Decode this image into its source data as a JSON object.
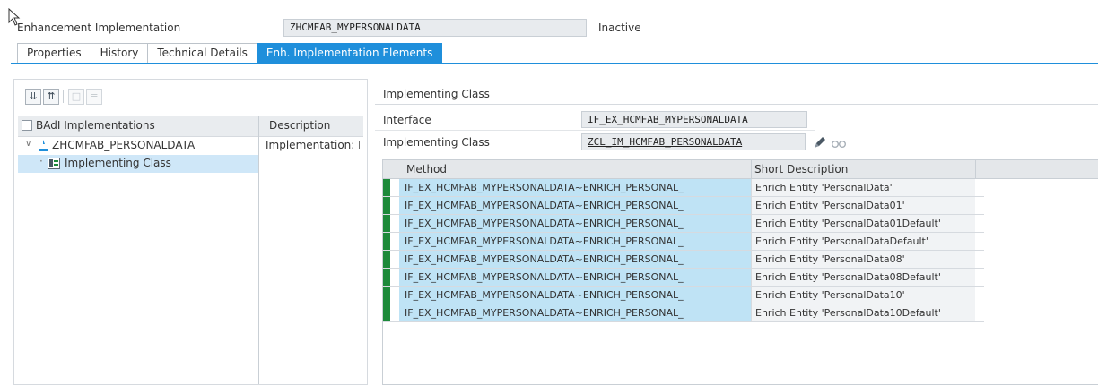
{
  "header": {
    "object_label": "Enhancement Implementation",
    "object_name": "ZHCMFAB_MYPERSONALDATA",
    "status": "Inactive"
  },
  "tabs": [
    {
      "label": "Properties",
      "active": false
    },
    {
      "label": "History",
      "active": false
    },
    {
      "label": "Technical Details",
      "active": false
    },
    {
      "label": "Enh. Implementation Elements",
      "active": true
    }
  ],
  "left_tree": {
    "toolbar": [
      "expand-all-icon",
      "collapse-all-icon",
      "new-icon",
      "delete-icon"
    ],
    "col_name": "BAdI Implementations",
    "col_desc": "Description",
    "rows": [
      {
        "label": "ZHCMFAB_PERSONALDATA",
        "desc": "Implementation: E",
        "level": 0,
        "selected": false
      },
      {
        "label": "Implementing Class",
        "desc": "",
        "level": 1,
        "selected": true
      }
    ]
  },
  "right": {
    "section_title": "Implementing Class",
    "interface_label": "Interface",
    "interface_value": "IF_EX_HCMFAB_MYPERSONALDATA",
    "class_label": "Implementing Class",
    "class_value": "ZCL_IM_HCMFAB_PERSONALDATA",
    "grid": {
      "col_method": "Method",
      "col_desc": "Short Description",
      "rows": [
        {
          "method": "IF_EX_HCMFAB_MYPERSONALDATA~ENRICH_PERSONAL_",
          "desc": "Enrich Entity 'PersonalData'"
        },
        {
          "method": "IF_EX_HCMFAB_MYPERSONALDATA~ENRICH_PERSONAL_",
          "desc": "Enrich Entity 'PersonalData01'"
        },
        {
          "method": "IF_EX_HCMFAB_MYPERSONALDATA~ENRICH_PERSONAL_",
          "desc": "Enrich Entity 'PersonalData01Default'"
        },
        {
          "method": "IF_EX_HCMFAB_MYPERSONALDATA~ENRICH_PERSONAL_",
          "desc": "Enrich Entity 'PersonalDataDefault'"
        },
        {
          "method": "IF_EX_HCMFAB_MYPERSONALDATA~ENRICH_PERSONAL_",
          "desc": "Enrich Entity 'PersonalData08'"
        },
        {
          "method": "IF_EX_HCMFAB_MYPERSONALDATA~ENRICH_PERSONAL_",
          "desc": "Enrich Entity 'PersonalData08Default'"
        },
        {
          "method": "IF_EX_HCMFAB_MYPERSONALDATA~ENRICH_PERSONAL_",
          "desc": "Enrich Entity 'PersonalData10'"
        },
        {
          "method": "IF_EX_HCMFAB_MYPERSONALDATA~ENRICH_PERSONAL_",
          "desc": "Enrich Entity 'PersonalData10Default'"
        }
      ]
    }
  },
  "colors": {
    "accent": "#1f8fdb",
    "row_status": "#1c8a3a",
    "method_highlight": "#bfe3f5"
  }
}
